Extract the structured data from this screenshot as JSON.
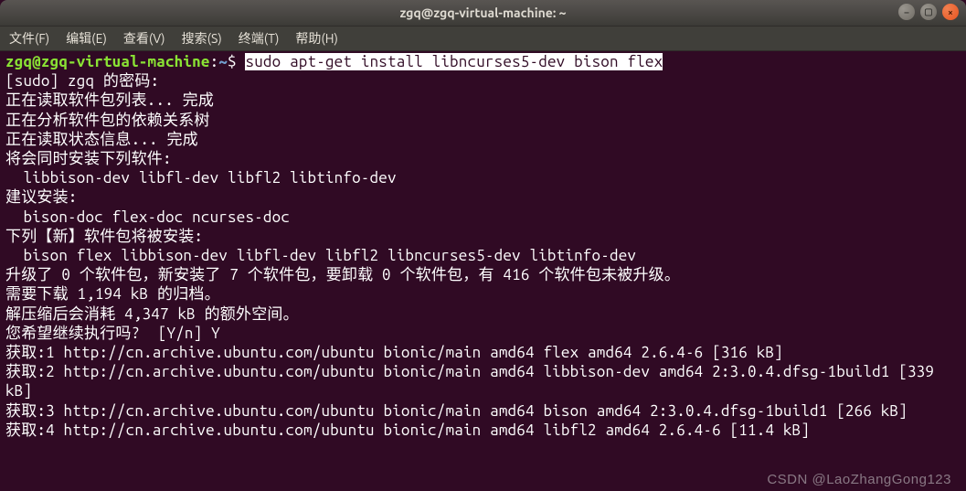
{
  "titlebar": {
    "title": "zgq@zgq-virtual-machine: ~"
  },
  "menubar": {
    "file": "文件(F)",
    "edit": "编辑(E)",
    "view": "查看(V)",
    "search": "搜索(S)",
    "terminal": "终端(T)",
    "help": "帮助(H)"
  },
  "prompt": {
    "userhost": "zgq@zgq-virtual-machine",
    "sep1": ":",
    "loc": "~",
    "sep2": "$ ",
    "command": "sudo apt-get install libncurses5-dev bison flex"
  },
  "lines": {
    "l01": "[sudo] zgq 的密码:",
    "l02": "正在读取软件包列表... 完成",
    "l03": "正在分析软件包的依赖关系树",
    "l04": "正在读取状态信息... 完成",
    "l05": "将会同时安装下列软件:",
    "l06": "  libbison-dev libfl-dev libfl2 libtinfo-dev",
    "l07": "建议安装:",
    "l08": "  bison-doc flex-doc ncurses-doc",
    "l09": "下列【新】软件包将被安装:",
    "l10": "  bison flex libbison-dev libfl-dev libfl2 libncurses5-dev libtinfo-dev",
    "l11": "升级了 0 个软件包，新安装了 7 个软件包，要卸载 0 个软件包，有 416 个软件包未被升级。",
    "l12": "需要下载 1,194 kB 的归档。",
    "l13": "解压缩后会消耗 4,347 kB 的额外空间。",
    "l14": "您希望继续执行吗?  [Y/n] Y",
    "l15": "获取:1 http://cn.archive.ubuntu.com/ubuntu bionic/main amd64 flex amd64 2.6.4-6 [316 kB]",
    "l16": "获取:2 http://cn.archive.ubuntu.com/ubuntu bionic/main amd64 libbison-dev amd64 2:3.0.4.dfsg-1build1 [339 kB]",
    "l17": "获取:3 http://cn.archive.ubuntu.com/ubuntu bionic/main amd64 bison amd64 2:3.0.4.dfsg-1build1 [266 kB]",
    "l18": "获取:4 http://cn.archive.ubuntu.com/ubuntu bionic/main amd64 libfl2 amd64 2.6.4-6 [11.4 kB]"
  },
  "watermark": "CSDN @LaoZhangGong123"
}
